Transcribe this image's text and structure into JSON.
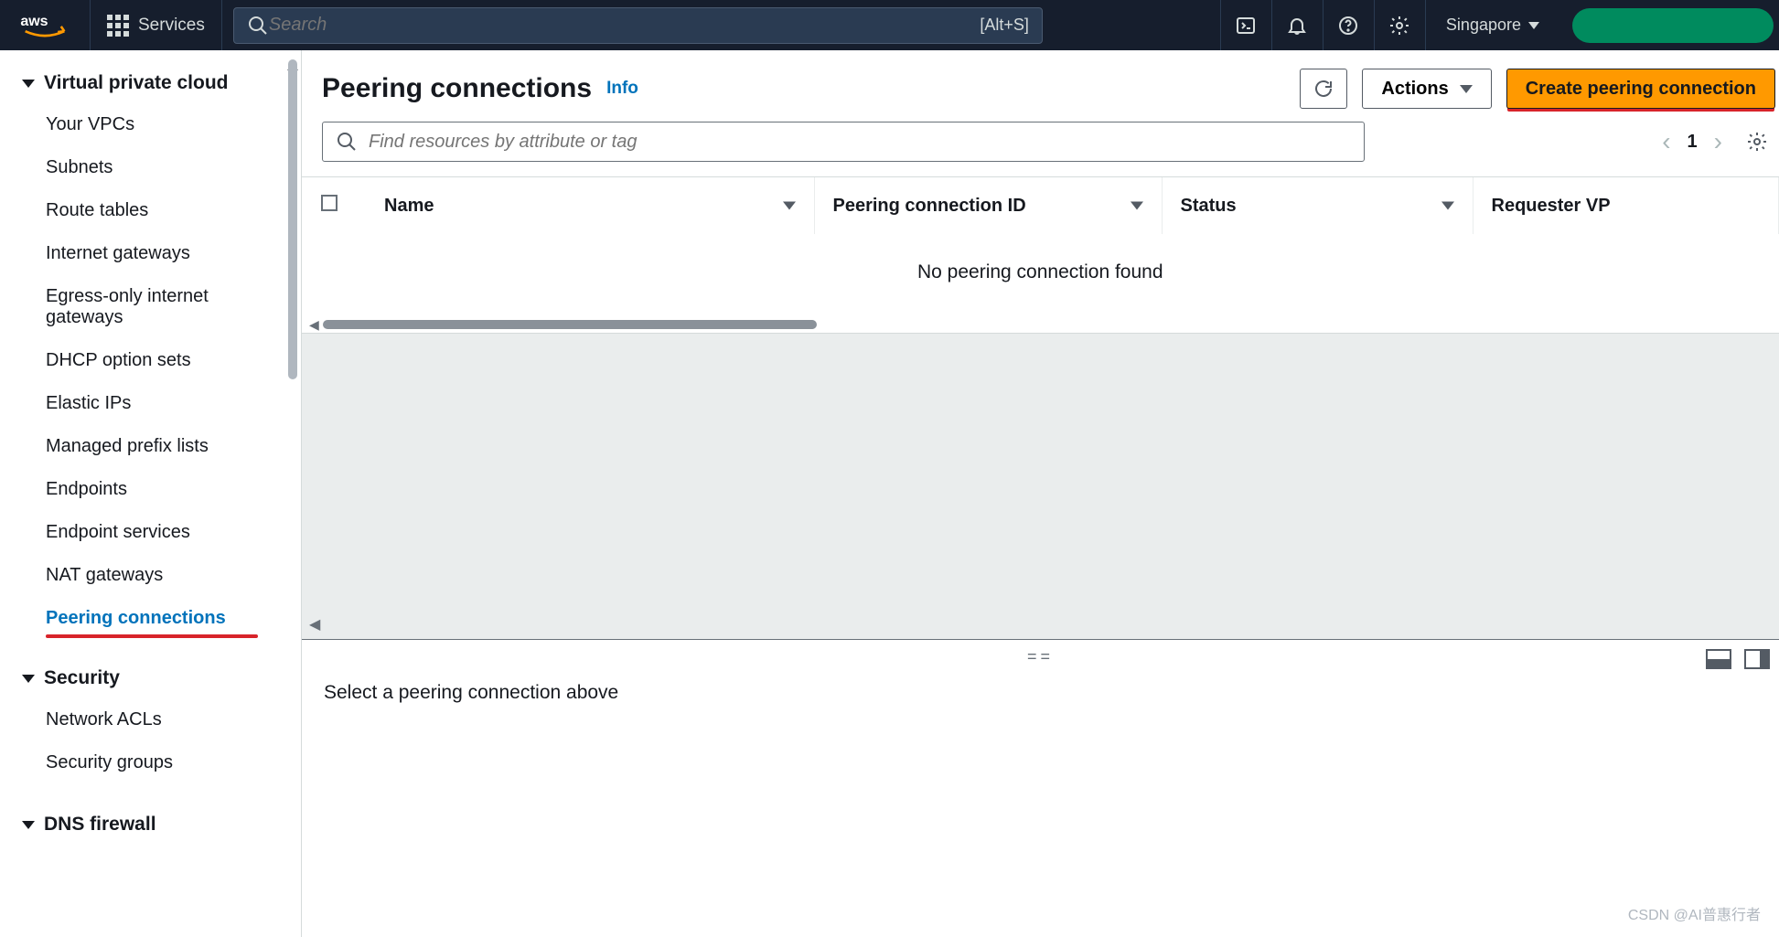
{
  "topnav": {
    "services_label": "Services",
    "search_placeholder": "Search",
    "search_shortcut": "[Alt+S]",
    "region": "Singapore"
  },
  "sidebar": {
    "sections": [
      {
        "title": "Virtual private cloud",
        "items": [
          "Your VPCs",
          "Subnets",
          "Route tables",
          "Internet gateways",
          "Egress-only internet gateways",
          "DHCP option sets",
          "Elastic IPs",
          "Managed prefix lists",
          "Endpoints",
          "Endpoint services",
          "NAT gateways",
          "Peering connections"
        ],
        "active_index": 11
      },
      {
        "title": "Security",
        "items": [
          "Network ACLs",
          "Security groups"
        ]
      },
      {
        "title": "DNS firewall",
        "items": []
      }
    ]
  },
  "page": {
    "title": "Peering connections",
    "info_label": "Info",
    "actions_label": "Actions",
    "create_label": "Create peering connection",
    "filter_placeholder": "Find resources by attribute or tag",
    "page_number": "1",
    "columns": [
      "Name",
      "Peering connection ID",
      "Status",
      "Requester VP"
    ],
    "empty_message": "No peering connection found",
    "detail_message": "Select a peering connection above"
  },
  "watermark": "CSDN @AI普惠行者"
}
